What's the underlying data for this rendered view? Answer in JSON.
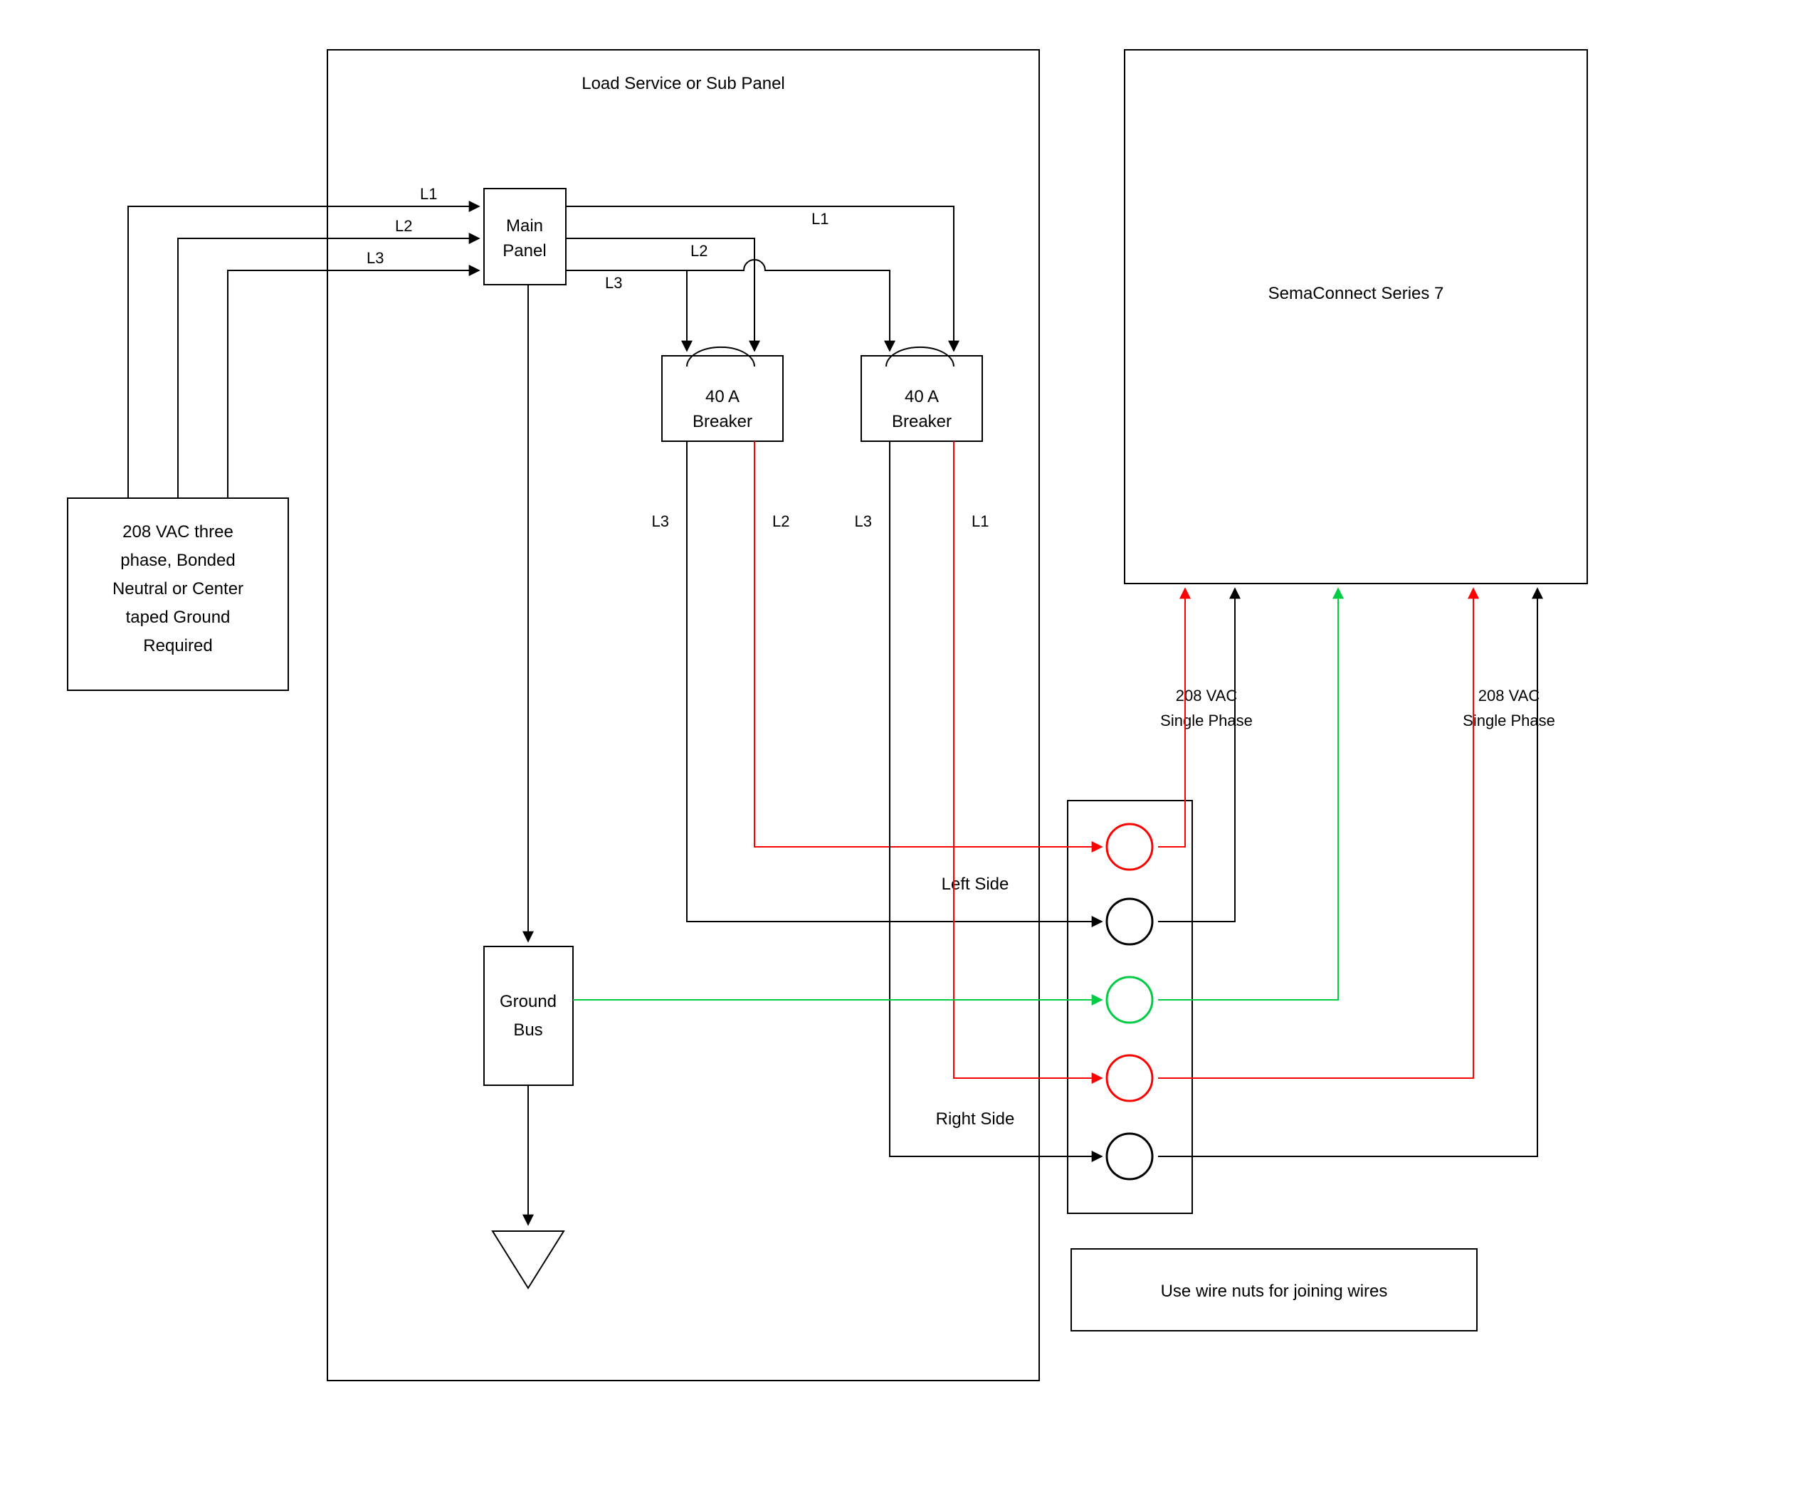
{
  "diagram": {
    "panel_title": "Load Service or Sub Panel",
    "source": {
      "line1": "208 VAC three",
      "line2": "phase, Bonded",
      "line3": "Neutral or Center",
      "line4": "taped Ground",
      "line5": "Required"
    },
    "main_panel": {
      "line1": "Main",
      "line2": "Panel"
    },
    "breaker_left": {
      "line1": "40 A",
      "line2": "Breaker"
    },
    "breaker_right": {
      "line1": "40 A",
      "line2": "Breaker"
    },
    "ground_bus": {
      "line1": "Ground",
      "line2": "Bus"
    },
    "device": "SemaConnect Series 7",
    "side_labels": {
      "left": "Left Side",
      "right": "Right Side"
    },
    "phase_notes": {
      "left": "208 VAC\nSingle Phase",
      "right": "208 VAC\nSingle Phase"
    },
    "note_box": "Use wire nuts for joining wires",
    "wires": {
      "L1_in": "L1",
      "L2_in": "L2",
      "L3_in": "L3",
      "L1_panel": "L1",
      "L2_panel": "L2",
      "L3_panel": "L3",
      "L3_b1": "L3",
      "L2_b1": "L2",
      "L3_b2": "L3",
      "L1_b2": "L1"
    },
    "colors": {
      "black": "#000000",
      "red": "#ff0000",
      "green": "#00cc44"
    }
  }
}
